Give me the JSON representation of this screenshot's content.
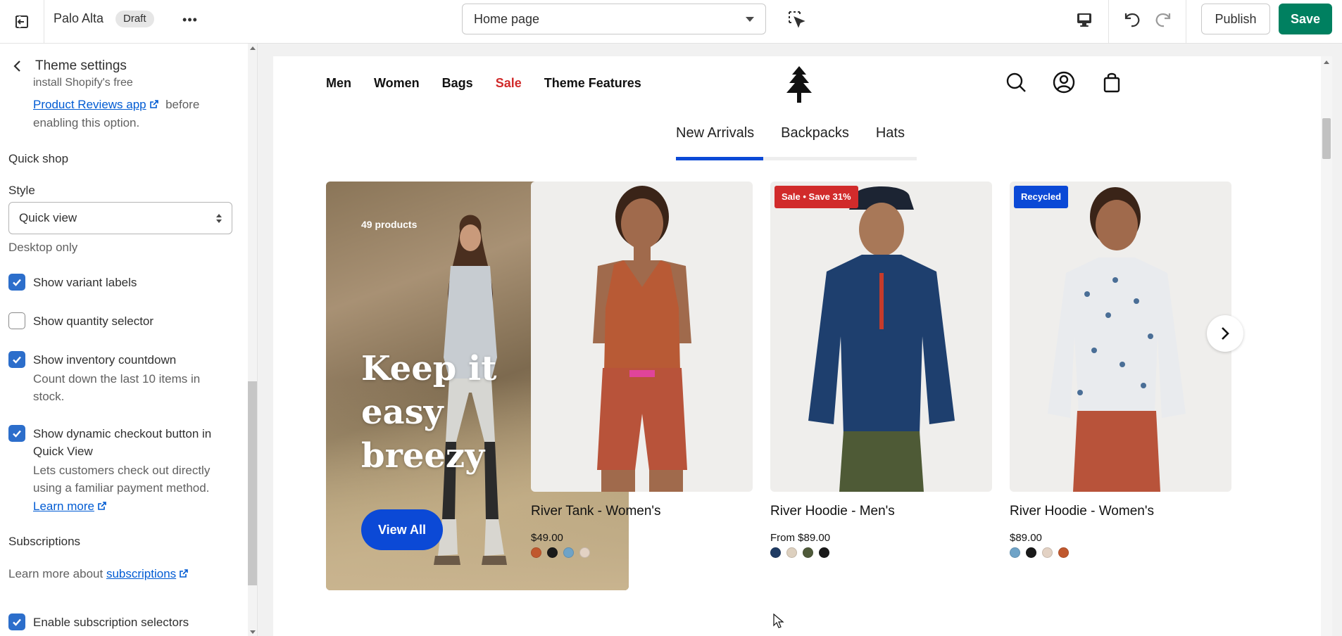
{
  "topbar": {
    "theme_name": "Palo Alta",
    "status_badge": "Draft",
    "page_selector": "Home page",
    "publish_label": "Publish",
    "save_label": "Save",
    "save_color": "#008060"
  },
  "sidebar": {
    "title": "Theme settings",
    "reviews_note_top": "install Shopify's free",
    "reviews_link": "Product Reviews app",
    "reviews_note_after": "before",
    "reviews_note_line3": "enabling this option.",
    "quick_shop_heading": "Quick shop",
    "style_label": "Style",
    "style_value": "Quick view",
    "style_help": "Desktop only",
    "checkboxes": [
      {
        "label": "Show variant labels",
        "checked": true
      },
      {
        "label": "Show quantity selector",
        "checked": false
      },
      {
        "label": "Show inventory countdown",
        "checked": true,
        "help": "Count down the last 10 items in stock."
      },
      {
        "label": "Show dynamic checkout button in Quick View",
        "checked": true,
        "help": "Lets customers check out directly using a familiar payment method.",
        "link": "Learn more"
      }
    ],
    "subscriptions_heading": "Subscriptions",
    "subscriptions_text": "Learn more about",
    "subscriptions_link": "subscriptions",
    "enable_subscriptions": {
      "label": "Enable subscription selectors",
      "checked": true
    }
  },
  "store": {
    "nav": [
      "Men",
      "Women",
      "Bags",
      "Sale",
      "Theme Features"
    ],
    "tabs": [
      "New Arrivals",
      "Backpacks",
      "Hats"
    ],
    "promo": {
      "count": "49 products",
      "title": "Keep it easy breezy",
      "button": "View All"
    },
    "products": [
      {
        "name": "River Tank - Women's",
        "price": "$49.00",
        "badge": "",
        "swatches": [
          "#c0582e",
          "#1a1a1a",
          "#6fa3c7",
          "#e3d2c4"
        ]
      },
      {
        "name": "River Hoodie - Men's",
        "price": "From $89.00",
        "badge": "Sale • Save 31%",
        "badge_color": "#d12b2b",
        "swatches": [
          "#1f3b63",
          "#ddd0bf",
          "#4f5a3a",
          "#1a1a1a"
        ]
      },
      {
        "name": "River Hoodie - Women's",
        "price": "$89.00",
        "badge": "Recycled",
        "badge_color": "#0b49d6",
        "swatches": [
          "#6fa3c7",
          "#1a1a1a",
          "#e3d2c4",
          "#c0582e"
        ]
      }
    ],
    "accent_color": "#0b49d6",
    "sale_color": "#d12b2b"
  }
}
